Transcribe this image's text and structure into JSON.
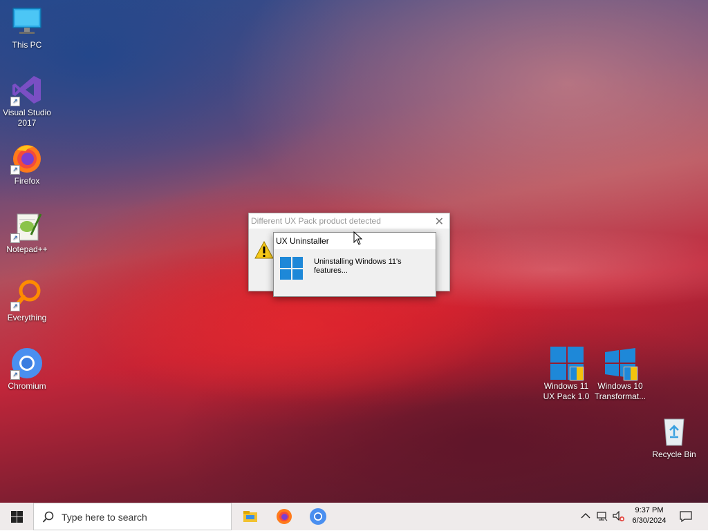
{
  "desktop": {
    "icons": [
      {
        "label": "This PC"
      },
      {
        "label": "Visual Studio 2017"
      },
      {
        "label": "Firefox"
      },
      {
        "label": "Notepad++"
      },
      {
        "label": "Everything"
      },
      {
        "label": "Chromium"
      },
      {
        "label": "Windows 11 UX Pack 1.0"
      },
      {
        "label": "Windows 10 Transformat..."
      },
      {
        "label": "Recycle Bin"
      }
    ]
  },
  "dialog_back": {
    "title": "Different UX Pack product detected",
    "close_glyph": "✕"
  },
  "dialog_front": {
    "title": "UX Uninstaller",
    "message": "Uninstalling Windows 11's features..."
  },
  "taskbar": {
    "search_placeholder": "Type here to search",
    "clock_time": "9:37 PM",
    "clock_date": "6/30/2024",
    "icons": [
      "windows-start-icon",
      "search-icon",
      "file-explorer-icon",
      "firefox-icon",
      "chromium-icon",
      "chevron-up-icon",
      "network-icon",
      "volume-muted-icon",
      "notification-icon"
    ]
  },
  "colors": {
    "accent": "#1e88d8",
    "taskbar_bg": "#efebeb"
  }
}
